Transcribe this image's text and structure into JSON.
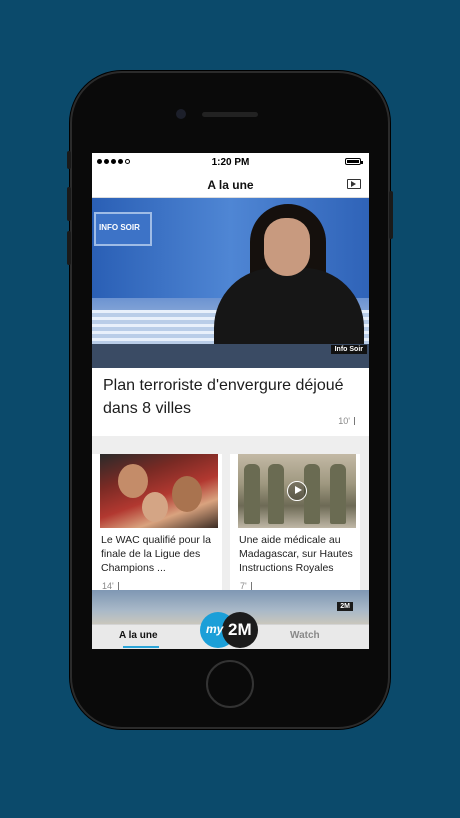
{
  "status_bar": {
    "time": "1:20 PM"
  },
  "nav": {
    "title": "A la une",
    "tv_icon": "tv-play-icon"
  },
  "hero": {
    "title": "Plan terroriste d'envergure déjoué dans 8 villes",
    "age": "10'",
    "screen_text": "INFO SOIR",
    "badge": "Info Soir"
  },
  "cards": [
    {
      "title": "Le WAC qualifié pour la finale de la Ligue des Champions ...",
      "age": "14'",
      "has_video": false
    },
    {
      "title": "Une aide médicale au Madagascar, sur Hautes Instructions Royales",
      "age": "7'",
      "has_video": true
    }
  ],
  "peek": {
    "channel_logo": "2M"
  },
  "tabbar": {
    "home_label": "A la une",
    "center_logo_my": "my",
    "center_logo_2m": "2M",
    "watch_label": "Watch",
    "accent": "#2ca5d8"
  }
}
